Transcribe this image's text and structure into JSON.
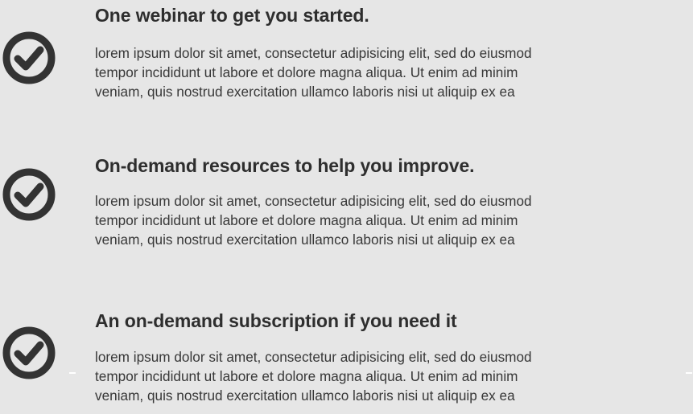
{
  "features": [
    {
      "title": "One webinar to get you started.",
      "lines": [
        "lorem ipsum dolor sit amet, consectetur adipisicing elit, sed do eiusmod",
        "tempor incididunt ut labore et dolore magna aliqua. Ut enim ad minim",
        "veniam, quis nostrud exercitation ullamco laboris nisi ut aliquip ex ea"
      ],
      "icon": "check-circle-icon"
    },
    {
      "title": "On-demand resources to help you improve.",
      "lines": [
        "lorem ipsum dolor sit amet, consectetur adipisicing elit, sed do eiusmod",
        "tempor incididunt ut labore et dolore magna aliqua. Ut enim ad minim",
        "veniam, quis nostrud exercitation ullamco laboris nisi ut aliquip ex ea"
      ],
      "icon": "check-circle-icon"
    },
    {
      "title": "An on-demand subscription if you need it",
      "lines": [
        "lorem ipsum dolor sit amet, consectetur adipisicing elit, sed do eiusmod",
        "tempor incididunt ut labore et dolore magna aliqua. Ut enim ad minim",
        "veniam, quis nostrud exercitation ullamco laboris nisi ut aliquip ex ea"
      ],
      "icon": "check-circle-icon"
    }
  ],
  "colors": {
    "background": "#e6e6e6",
    "icon": "#333333",
    "title": "#2e2e2e",
    "body": "#383838"
  }
}
